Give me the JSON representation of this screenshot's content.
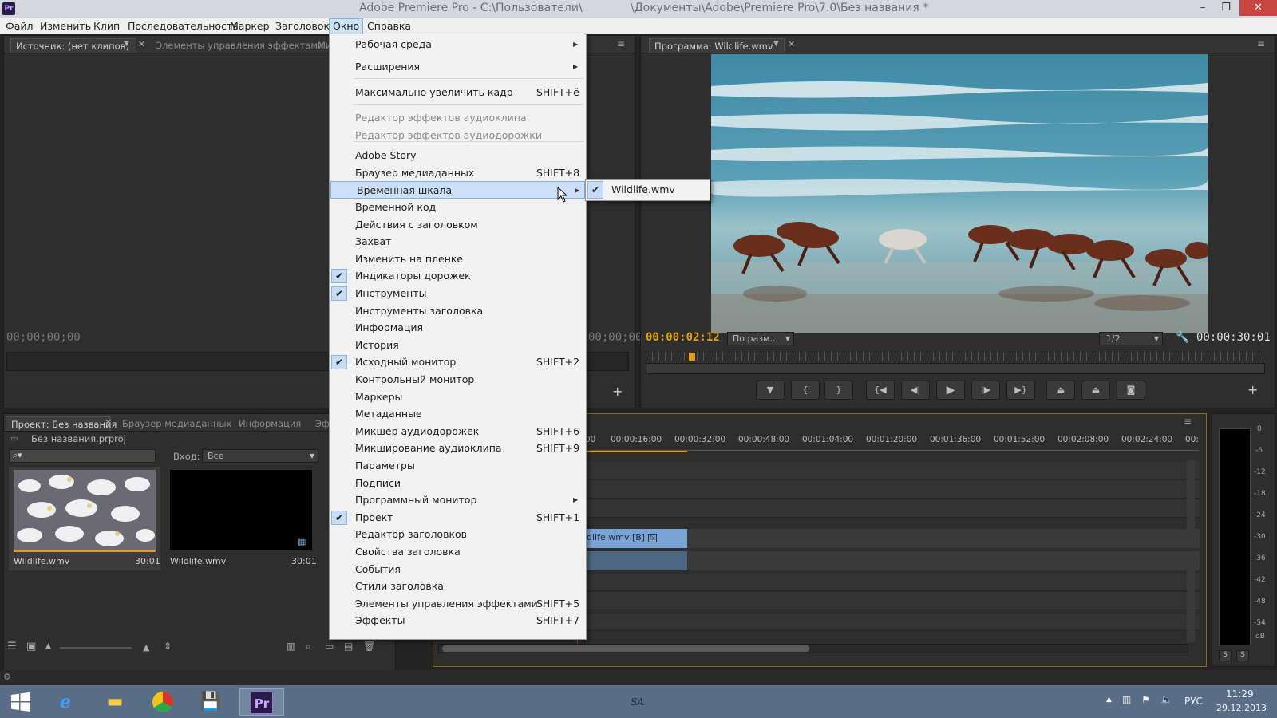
{
  "window": {
    "app_icon_text": "Pr",
    "title_part1": "Adobe Premiere Pro - C:\\Пользователи\\",
    "title_part2": "\\Документы\\Adobe\\Premiere Pro\\7.0\\Без названия *",
    "min_glyph": "–",
    "max_glyph": "❐",
    "close_glyph": "✕"
  },
  "menubar": {
    "items": [
      "Файл",
      "Изменить",
      "Клип",
      "Последовательность",
      "Маркер",
      "Заголовок",
      "Окно",
      "Справка"
    ],
    "active": "Окно"
  },
  "source_panel": {
    "tab_source": "Источник: (нет клипов)",
    "tab_effect_controls": "Элементы управления эффектами",
    "tab_more": "Ми",
    "timecode_left": "00;00;00;00",
    "timecode_right": "00;00;00"
  },
  "program_panel": {
    "tab": "Программа: Wildlife.wmv",
    "timecode_current": "00:00:02:12",
    "zoom_fit": "По разм...",
    "resolution": "1/2",
    "timecode_duration": "00:00:30:01"
  },
  "project_panel": {
    "tab_project": "Проект: Без названия",
    "tab_media_browser": "Браузер медиаданных",
    "tab_info": "Информация",
    "tab_more": "Эф",
    "project_file": "Без названия.prproj",
    "search_placeholder": "",
    "in_label": "Вход:",
    "in_value": "Все",
    "clips": [
      {
        "name": "Wildlife.wmv",
        "duration": "30:01"
      },
      {
        "name": "Wildlife.wmv",
        "duration": "30:01"
      }
    ]
  },
  "timeline": {
    "ruler": [
      "00",
      "00:00:16:00",
      "00:00:32:00",
      "00:00:48:00",
      "00:01:04:00",
      "00:01:20:00",
      "00:01:36:00",
      "00:01:52:00",
      "00:02:08:00",
      "00:02:24:00",
      "00:"
    ],
    "video_clip_label": "dlife.wmv [В]",
    "fx_badge": "fx"
  },
  "audio_meter": {
    "scale": [
      "0",
      "-6",
      "-12",
      "-18",
      "-24",
      "-30",
      "-36",
      "-42",
      "-48",
      "-54",
      "dB"
    ],
    "solo_left": "S",
    "solo_right": "S"
  },
  "menu": {
    "items": [
      {
        "label": "Рабочая среда",
        "submenu": true
      },
      {
        "label": "Расширения",
        "submenu": true
      },
      {
        "label": "Максимально увеличить кадр",
        "shortcut": "SHIFT+ё"
      },
      {
        "label": "Редактор эффектов аудиоклипа",
        "disabled": true
      },
      {
        "label": "Редактор эффектов аудиодорожки",
        "disabled": true
      },
      {
        "label": "Adobe Story"
      },
      {
        "label": "Браузер медиаданных",
        "shortcut": "SHIFT+8"
      },
      {
        "label": "Временная шкала",
        "submenu": true,
        "highlighted": true
      },
      {
        "label": "Временной код"
      },
      {
        "label": "Действия с заголовком"
      },
      {
        "label": "Захват"
      },
      {
        "label": "Изменить на пленке"
      },
      {
        "label": "Индикаторы дорожек",
        "checked": true
      },
      {
        "label": "Инструменты",
        "checked": true
      },
      {
        "label": "Инструменты заголовка"
      },
      {
        "label": "Информация"
      },
      {
        "label": "История"
      },
      {
        "label": "Исходный монитор",
        "shortcut": "SHIFT+2",
        "checked": true
      },
      {
        "label": "Контрольный монитор"
      },
      {
        "label": "Маркеры"
      },
      {
        "label": "Метаданные"
      },
      {
        "label": "Микшер аудиодорожек",
        "shortcut": "SHIFT+6"
      },
      {
        "label": "Микширование аудиоклипа",
        "shortcut": "SHIFT+9"
      },
      {
        "label": "Параметры"
      },
      {
        "label": "Подписи"
      },
      {
        "label": "Программный монитор",
        "submenu": true
      },
      {
        "label": "Проект",
        "shortcut": "SHIFT+1",
        "checked": true
      },
      {
        "label": "Редактор заголовков"
      },
      {
        "label": "Свойства заголовка"
      },
      {
        "label": "События"
      },
      {
        "label": "Стили заголовка"
      },
      {
        "label": "Элементы управления эффектами",
        "shortcut": "SHIFT+5"
      },
      {
        "label": "Эффекты",
        "shortcut": "SHIFT+7"
      }
    ],
    "check_glyph": "✔",
    "arrow_glyph": "▶"
  },
  "submenu": {
    "items": [
      {
        "label": "Wildlife.wmv",
        "checked": true
      }
    ]
  },
  "taskbar": {
    "watermark": "SA",
    "lang": "РУС",
    "time": "11:29",
    "date": "29.12.2013",
    "icons": [
      "windows-start-icon",
      "internet-explorer-icon",
      "file-explorer-icon",
      "office-icon",
      "save-floppy-icon",
      "premiere-pro-icon"
    ]
  },
  "colors": {
    "accent_timecode": "#e0a10e",
    "menu_highlight": "#cbe0f8",
    "taskbar": "#5a6d86",
    "close_red": "#c7463f",
    "clip_blue": "#7ba4d6"
  }
}
